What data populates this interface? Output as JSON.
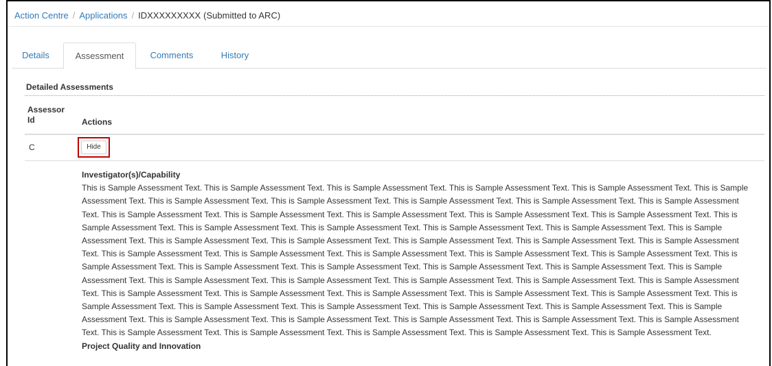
{
  "breadcrumb": {
    "items": [
      "Action Centre",
      "Applications"
    ],
    "separator": "/",
    "current_id": "IDXXXXXXXXX",
    "status": "(Submitted to ARC)"
  },
  "tabs": [
    {
      "label": "Details",
      "active": false
    },
    {
      "label": "Assessment",
      "active": true
    },
    {
      "label": "Comments",
      "active": false
    },
    {
      "label": "History",
      "active": false
    }
  ],
  "section": {
    "title": "Detailed Assessments"
  },
  "table": {
    "headers": {
      "assessor_id": "Assessor Id",
      "actions": "Actions"
    },
    "rows": [
      {
        "assessor_id": "C",
        "action_label": "Hide"
      }
    ]
  },
  "assessment": {
    "sections": [
      {
        "heading": "Investigator(s)/Capability",
        "text": "This is Sample Assessment Text. This is Sample Assessment Text. This is Sample Assessment Text. This is Sample Assessment Text. This is Sample Assessment Text. This is Sample Assessment Text. This is Sample Assessment Text. This is Sample Assessment Text. This is Sample Assessment Text. This is Sample Assessment Text. This is Sample Assessment Text. This is Sample Assessment Text. This is Sample Assessment Text. This is Sample Assessment Text. This is Sample Assessment Text. This is Sample Assessment Text. This is Sample Assessment Text. This is Sample Assessment Text. This is Sample Assessment Text. This is Sample Assessment Text. This is Sample Assessment Text. This is Sample Assessment Text. This is Sample Assessment Text. This is Sample Assessment Text. This is Sample Assessment Text. This is Sample Assessment Text. This is Sample Assessment Text. This is Sample Assessment Text. This is Sample Assessment Text. This is Sample Assessment Text. This is Sample Assessment Text. This is Sample Assessment Text. This is Sample Assessment Text. This is Sample Assessment Text. This is Sample Assessment Text. This is Sample Assessment Text. This is Sample Assessment Text. This is Sample Assessment Text. This is Sample Assessment Text. This is Sample Assessment Text. This is Sample Assessment Text. This is Sample Assessment Text. This is Sample Assessment Text. This is Sample Assessment Text. This is Sample Assessment Text. This is Sample Assessment Text. This is Sample Assessment Text. This is Sample Assessment Text. This is Sample Assessment Text. This is Sample Assessment Text. This is Sample Assessment Text. This is Sample Assessment Text. This is Sample Assessment Text. This is Sample Assessment Text. This is Sample Assessment Text. This is Sample Assessment Text. This is Sample Assessment Text. This is Sample Assessment Text. This is Sample Assessment Text. This is Sample Assessment Text. This is Sample Assessment Text. This is Sample Assessment Text. This is Sample Assessment Text. This is Sample Assessment Text."
      },
      {
        "heading": "Project Quality and Innovation",
        "text": ""
      }
    ]
  },
  "colors": {
    "link": "#337ab7",
    "text": "#333333",
    "highlight_border": "#c00000",
    "frame_border": "#000000",
    "divider": "#dddddd"
  }
}
